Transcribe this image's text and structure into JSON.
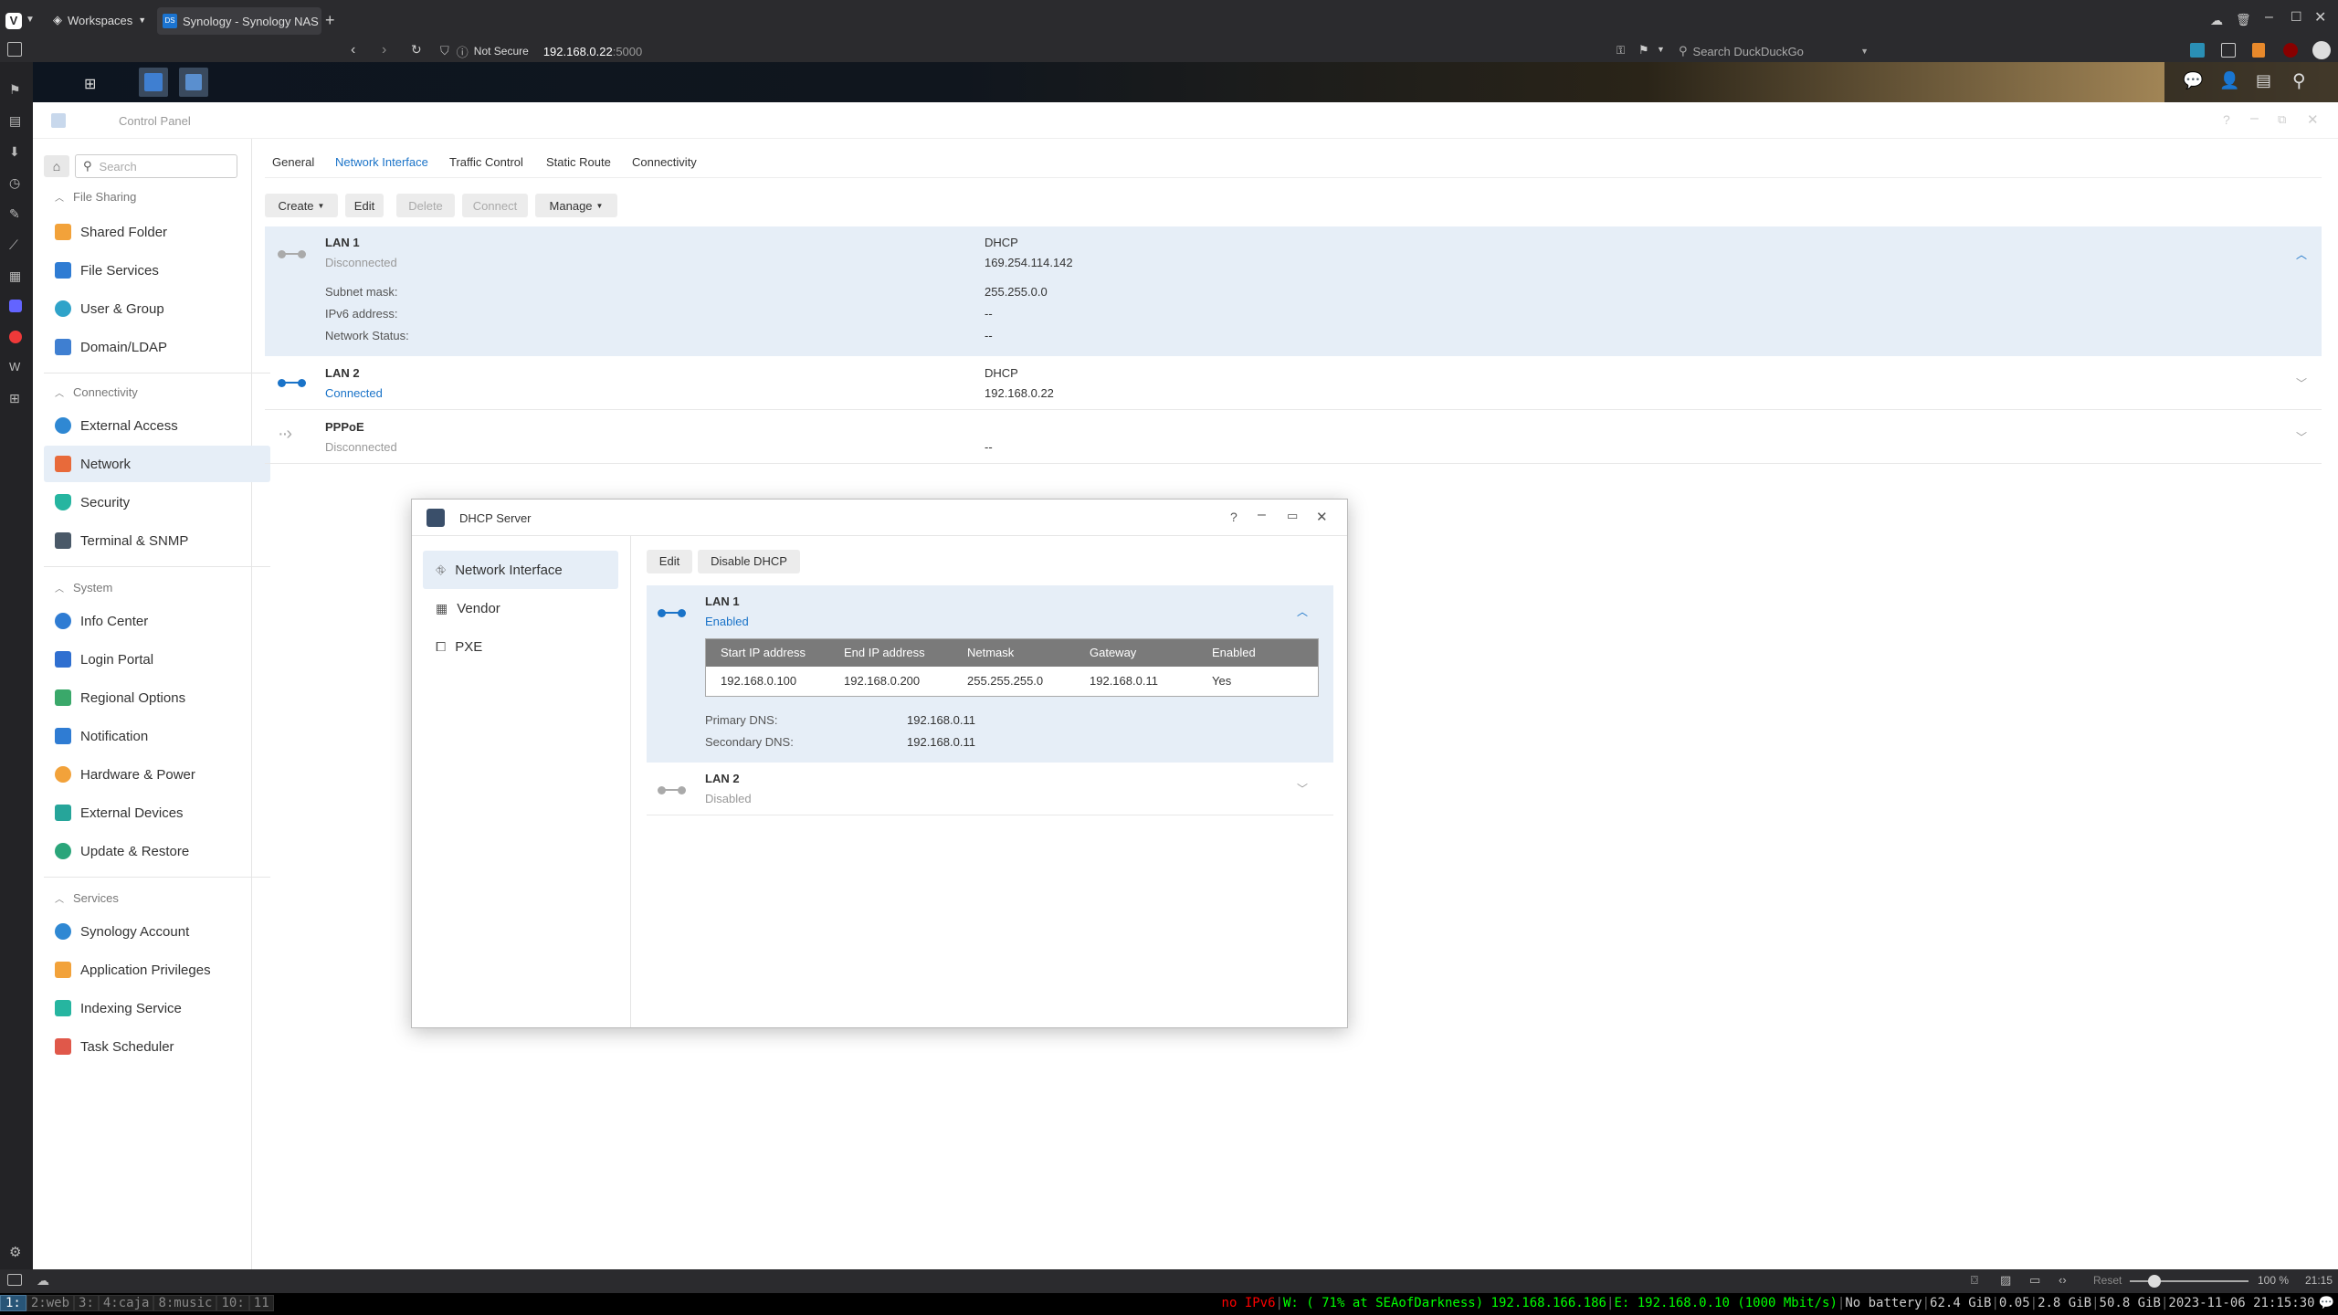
{
  "browser": {
    "workspaces_label": "Workspaces",
    "tab_title": "Synology - Synology NAS",
    "not_secure": "Not Secure",
    "url_host": "192.168.0.22",
    "url_port": ":5000",
    "search_placeholder": "Search DuckDuckGo"
  },
  "control_panel": {
    "title": "Control Panel",
    "search_placeholder": "Search",
    "sections": [
      {
        "title": "File Sharing",
        "items": [
          "Shared Folder",
          "File Services",
          "User & Group",
          "Domain/LDAP"
        ]
      },
      {
        "title": "Connectivity",
        "items": [
          "External Access",
          "Network",
          "Security",
          "Terminal & SNMP"
        ]
      },
      {
        "title": "System",
        "items": [
          "Info Center",
          "Login Portal",
          "Regional Options",
          "Notification",
          "Hardware & Power",
          "External Devices",
          "Update & Restore"
        ]
      },
      {
        "title": "Services",
        "items": [
          "Synology Account",
          "Application Privileges",
          "Indexing Service",
          "Task Scheduler"
        ]
      }
    ],
    "tabs": [
      "General",
      "Network Interface",
      "Traffic Control",
      "Static Route",
      "Connectivity"
    ],
    "toolbar": [
      "Create",
      "Edit",
      "Delete",
      "Connect",
      "Manage"
    ],
    "interfaces": [
      {
        "name": "LAN 1",
        "status": "Disconnected",
        "type": "DHCP",
        "ip": "169.254.114.142",
        "subnet_label": "Subnet mask:",
        "subnet": "255.255.0.0",
        "ipv6_label": "IPv6 address:",
        "ipv6": "--",
        "netstatus_label": "Network Status:",
        "netstatus": "--"
      },
      {
        "name": "LAN 2",
        "status": "Connected",
        "type": "DHCP",
        "ip": "192.168.0.22"
      },
      {
        "name": "PPPoE",
        "status": "Disconnected",
        "ip": "--"
      }
    ]
  },
  "dhcp_dialog": {
    "title": "DHCP Server",
    "nav": [
      "Network Interface",
      "Vendor",
      "PXE"
    ],
    "buttons": [
      "Edit",
      "Disable DHCP"
    ],
    "lan1": {
      "name": "LAN 1",
      "status": "Enabled"
    },
    "table_headers": [
      "Start IP address",
      "End IP address",
      "Netmask",
      "Gateway",
      "Enabled"
    ],
    "table_row": [
      "192.168.0.100",
      "192.168.0.200",
      "255.255.255.0",
      "192.168.0.11",
      "Yes"
    ],
    "primary_dns_label": "Primary DNS:",
    "primary_dns": "192.168.0.11",
    "secondary_dns_label": "Secondary DNS:",
    "secondary_dns": "192.168.0.11",
    "lan2": {
      "name": "LAN 2",
      "status": "Disabled"
    }
  },
  "statusbar": {
    "reset": "Reset",
    "zoom": "100 %",
    "time": "21:15"
  },
  "i3bar": {
    "workspaces": [
      "1:",
      "2:web",
      "3:",
      "4:caja",
      "8:music",
      "10:",
      "11"
    ],
    "no_ipv6": "no IPv6",
    "wifi": "W: ( 71% at SEAofDarkness) 192.168.166.186",
    "eth": "E: 192.168.0.10 (1000 Mbit/s)",
    "battery": "No battery",
    "disk": "62.4 GiB",
    "load": "0.05",
    "mem": "2.8 GiB",
    "disk2": "50.8 GiB",
    "datetime": "2023-11-06 21:15:30"
  },
  "colors": {
    "accent": "#1a73c8",
    "selection": "#e6eef7",
    "dialog_table_header": "#7a7a7a"
  }
}
